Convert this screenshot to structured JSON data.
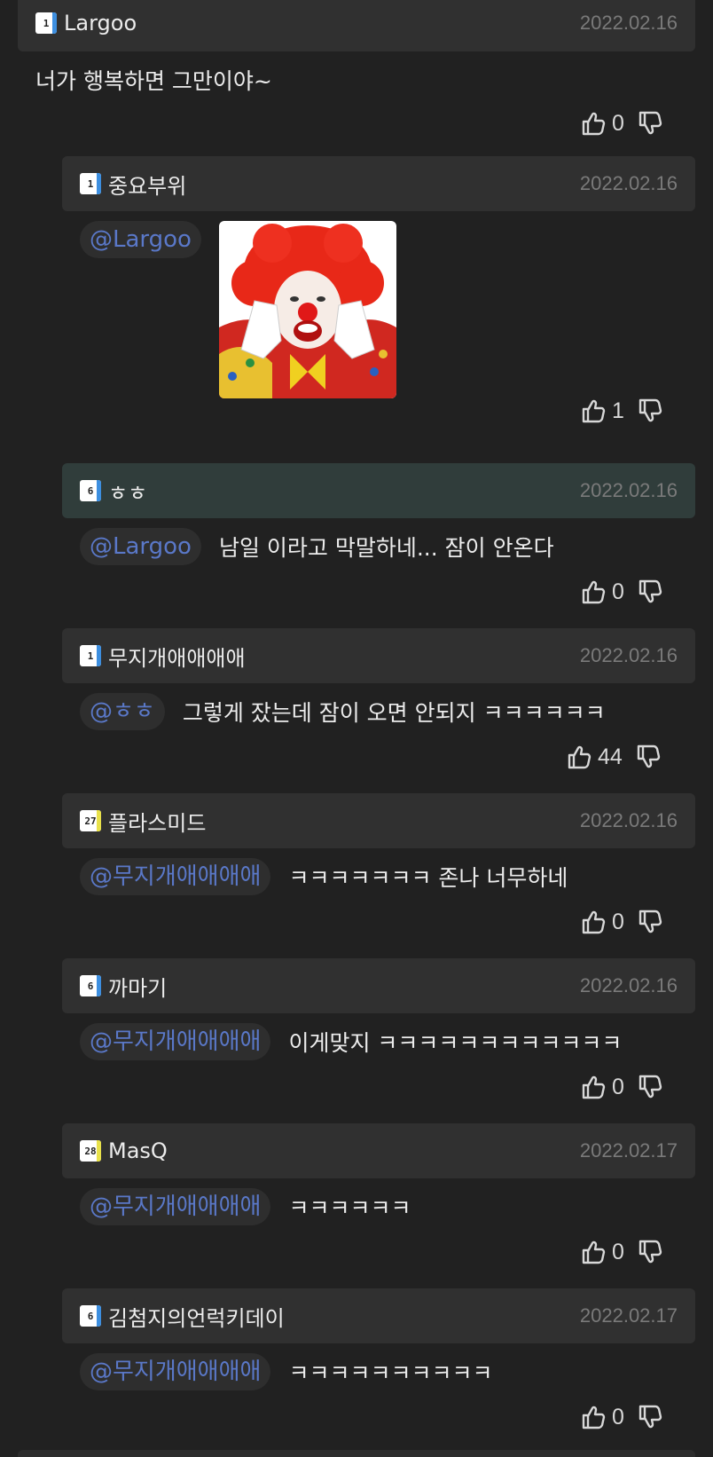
{
  "colors": {
    "background": "#212121",
    "header": "#303030",
    "header_active": "#303d3b",
    "mention_text": "#5a78c8",
    "date_text": "#7a7a7a"
  },
  "post": {
    "nickname": "Largoo",
    "level": "1",
    "level_color": "#3d8fe0",
    "date": "2022.02.16",
    "text": "너가 행복하면 그만이야~",
    "likes": "0"
  },
  "replies": [
    {
      "nickname": "중요부위",
      "level": "1",
      "level_color": "#3d8fe0",
      "date": "2022.02.16",
      "mention": "@Largoo",
      "text": "",
      "has_image": true,
      "image_icon": "clown-image",
      "likes": "1",
      "active": false
    },
    {
      "nickname": "ㅎㅎ",
      "level": "6",
      "level_color": "#3d8fe0",
      "date": "2022.02.16",
      "mention": "@Largoo",
      "text": "남일 이라고 막말하네... 잠이 안온다",
      "likes": "0",
      "active": true
    },
    {
      "nickname": "무지개애애애애",
      "level": "1",
      "level_color": "#3d8fe0",
      "date": "2022.02.16",
      "mention": "@ㅎㅎ",
      "text": "그렇게 잤는데 잠이 오면 안되지 ㅋㅋㅋㅋㅋㅋ",
      "likes": "44",
      "active": false
    },
    {
      "nickname": "플라스미드",
      "level": "27",
      "level_color": "#e8e14a",
      "date": "2022.02.16",
      "mention": "@무지개애애애애",
      "text": "ㅋㅋㅋㅋㅋㅋㅋ 존나 너무하네",
      "likes": "0",
      "active": false
    },
    {
      "nickname": "까마기",
      "level": "6",
      "level_color": "#3d8fe0",
      "date": "2022.02.16",
      "mention": "@무지개애애애애",
      "text": "이게맞지 ㅋㅋㅋㅋㅋㅋㅋㅋㅋㅋㅋㅋ",
      "likes": "0",
      "active": false
    },
    {
      "nickname": "MasQ",
      "level": "28",
      "level_color": "#e8e14a",
      "date": "2022.02.17",
      "mention": "@무지개애애애애",
      "text": "ㅋㅋㅋㅋㅋㅋ",
      "likes": "0",
      "active": false
    },
    {
      "nickname": "김첨지의언럭키데이",
      "level": "6",
      "level_color": "#3d8fe0",
      "date": "2022.02.17",
      "mention": "@무지개애애애애",
      "text": "ㅋㅋㅋㅋㅋㅋㅋㅋㅋㅋ",
      "likes": "0",
      "active": false
    }
  ]
}
